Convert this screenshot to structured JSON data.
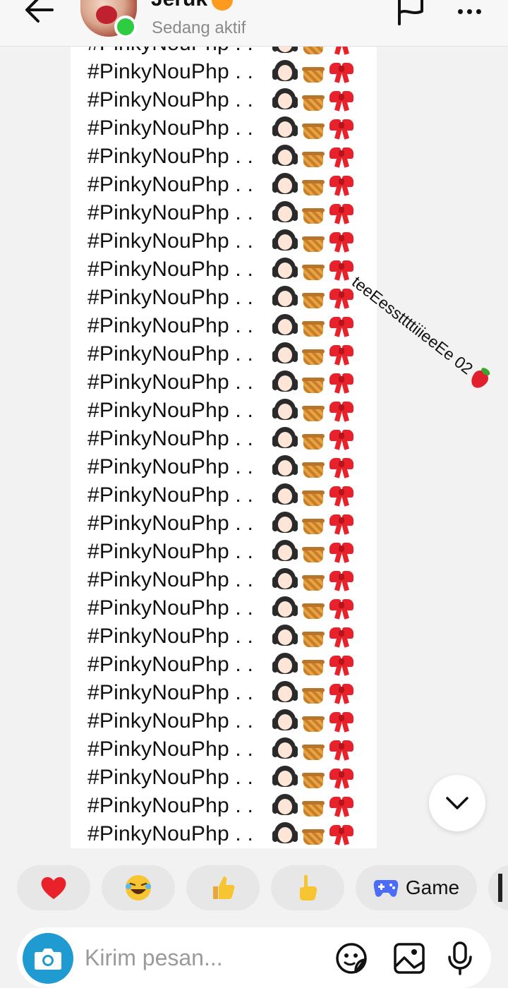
{
  "header": {
    "contact_name": "Jeruk",
    "status": "Sedang aktif"
  },
  "message": {
    "repeated_line": "#PinkyNouPhp . .",
    "line_count": 29
  },
  "side_caption": "teeEessttttiiieeEe 02",
  "quick_replies": {
    "items": [
      {
        "name": "heart",
        "emoji": "❤️"
      },
      {
        "name": "laugh",
        "emoji": "😂"
      },
      {
        "name": "thumbs-up",
        "emoji": "👍"
      },
      {
        "name": "pointing",
        "emoji": "👆"
      }
    ],
    "game_label": "Game"
  },
  "composer": {
    "placeholder": "Kirim pesan..."
  },
  "colors": {
    "background": "#f2f2f2",
    "online": "#2ecc40",
    "camera": "#1f9bd1",
    "chip": "#e7e7e7",
    "heart": "#e8212b",
    "game_controller": "#4a6cf7"
  },
  "icons": [
    "back-arrow-icon",
    "flag-icon",
    "more-icon",
    "chevron-down-icon",
    "camera-icon",
    "sticker-icon",
    "gallery-icon",
    "microphone-icon",
    "game-controller-icon"
  ]
}
